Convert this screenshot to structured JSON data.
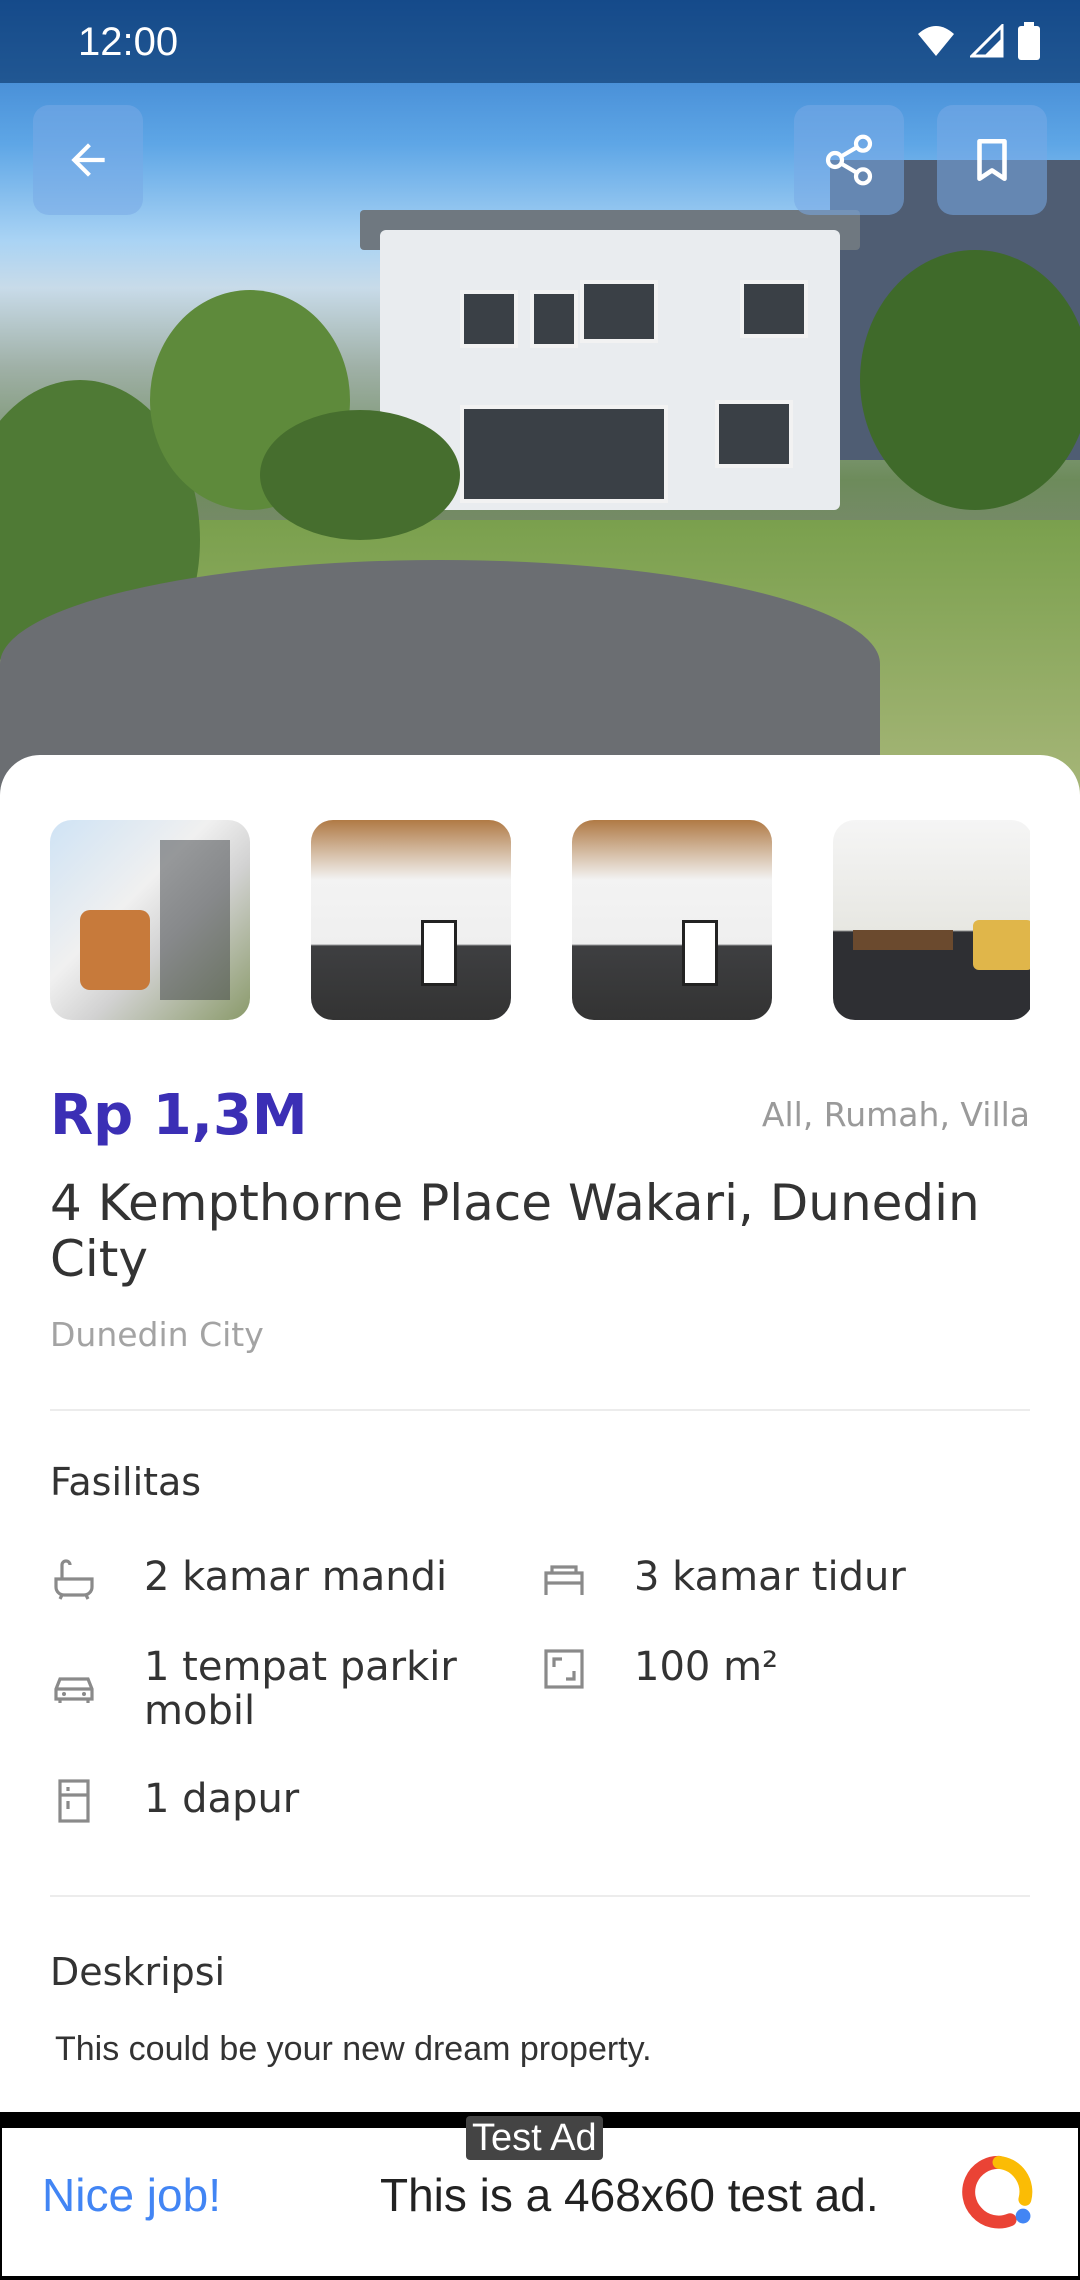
{
  "status_bar": {
    "time": "12:00"
  },
  "listing": {
    "price": "Rp 1,3M",
    "tags": "All, Rumah, Villa",
    "title": "4 Kempthorne Place Wakari, Dunedin City",
    "city": "Dunedin City"
  },
  "facilities": {
    "heading": "Fasilitas",
    "items": [
      {
        "icon": "bathtub-icon",
        "label": "2 kamar mandi"
      },
      {
        "icon": "bed-icon",
        "label": "3 kamar tidur"
      },
      {
        "icon": "car-icon",
        "label": "1 tempat parkir mobil"
      },
      {
        "icon": "area-icon",
        "label": "100 m²"
      },
      {
        "icon": "kitchen-icon",
        "label": "1 dapur"
      }
    ]
  },
  "description": {
    "heading": "Deskripsi",
    "text": "This could be your new dream property."
  },
  "ad": {
    "tag": "Test Ad",
    "brand": "Nice job!",
    "text": "This is a 468x60 test ad."
  },
  "colors": {
    "accent": "#3b2fb5",
    "muted": "#a3a3a3",
    "ad_link": "#4285f4"
  }
}
